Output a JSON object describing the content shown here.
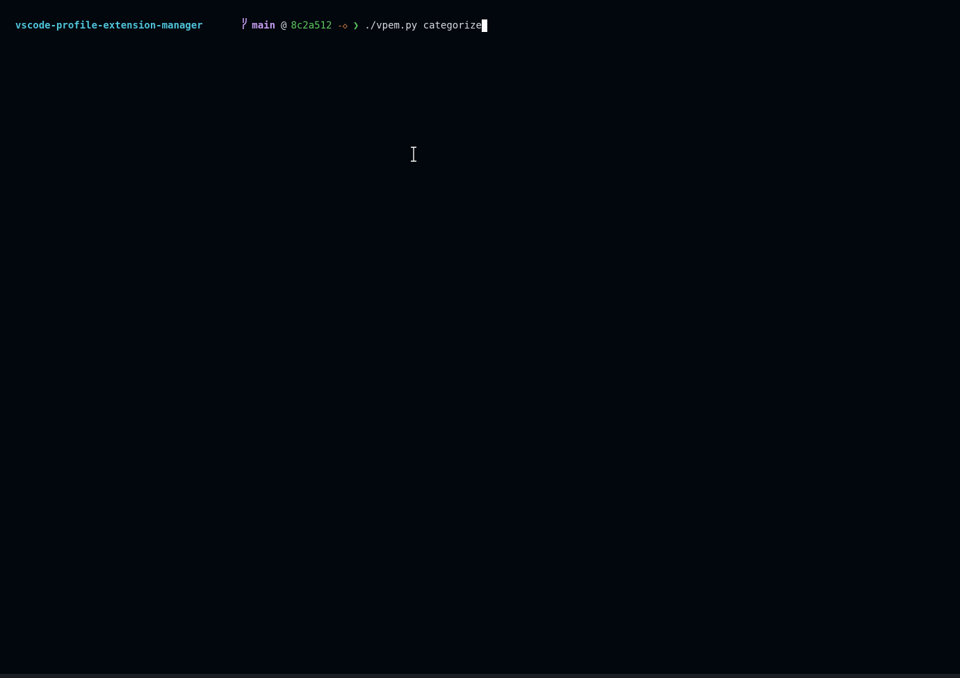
{
  "prompt": {
    "directory": "vscode-profile-extension-manager",
    "branch_icon": "git-branch-icon",
    "branch": "main",
    "at": "@",
    "commit": "8c2a512",
    "status": "-◇",
    "arrow": "❯",
    "command": "./vpem.py categorize"
  },
  "colors": {
    "background": "#02060d",
    "directory": "#4fc3d9",
    "branch": "#c59cf0",
    "commit": "#5fc75f",
    "status": "#e0894a",
    "arrow": "#5fc75f",
    "text": "#d6dae0"
  },
  "icons": {
    "mouse_cursor": "text-cursor-icon"
  }
}
